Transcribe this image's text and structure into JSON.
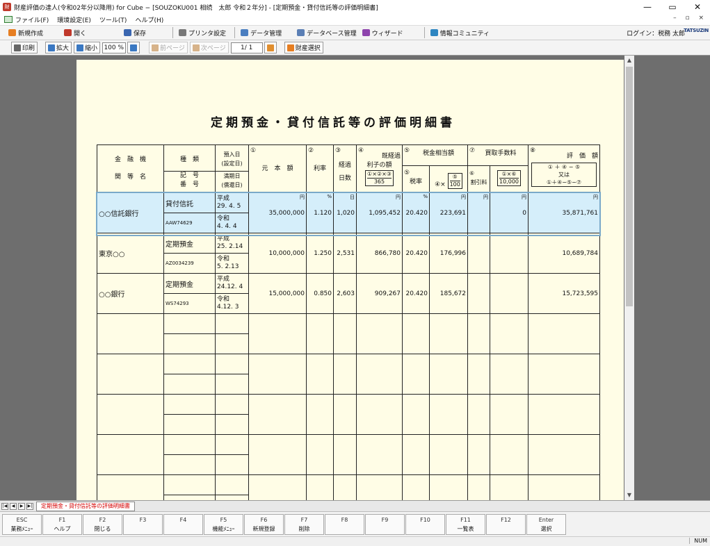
{
  "window": {
    "title": "財産評価の達人(令和02年分以降用) for Cube − [SOUZOKU001 相続　太郎 令和２年分] - [定期預金・貸付信託等の評価明細書]",
    "controls": [
      "—",
      "▭",
      "✕"
    ]
  },
  "menu": {
    "items": [
      "ファイル(F)",
      "環境設定(E)",
      "ツール(T)",
      "ヘルプ(H)"
    ],
    "mdi_controls": "– ▫ ×"
  },
  "toolbar1": {
    "new_label": "新規作成",
    "open_label": "開く",
    "save_label": "保存",
    "printer_label": "プリンタ設定",
    "data_mgmt_label": "データ管理",
    "db_mgmt_label": "データベース管理",
    "wizard_label": "ウィザード",
    "community_label": "情報コミュニティ",
    "login_text": "ログイン：税務 太郎",
    "brand": "TATSUZIN"
  },
  "toolbar2": {
    "print_label": "印刷",
    "zoom_in_label": "拡大",
    "zoom_out_label": "縮小",
    "zoom_value": "100 %",
    "prev_page_label": "前ページ",
    "next_page_label": "次ページ",
    "page_value": "1/ 1",
    "asset_select_label": "財産選択"
  },
  "document": {
    "title": "定期預金・貸付信託等の評価明細書",
    "headers": {
      "bank_top": "金　融　機",
      "bank_bottom": "関　等　名",
      "kind_top": "種　類",
      "kind_bottom1": "記　号",
      "kind_bottom2": "番　号",
      "deposit_date_top1": "預入日",
      "deposit_date_top2": "(設定日)",
      "deposit_date_bottom1": "満期日",
      "deposit_date_bottom2": "(償還日)",
      "principal_no": "①",
      "principal": "元　本　額",
      "rate_no": "②",
      "rate": "利率",
      "days_no": "③",
      "days1": "経過",
      "days2": "日数",
      "interest_no": "④",
      "interest1": "既経過",
      "interest2": "利子の額",
      "interest_formula_top": "①×②×③",
      "interest_formula_bottom": "365",
      "tax_no": "⑤",
      "tax": "税金相当額",
      "tax_rate_no": "⑤",
      "tax_rate": "税率",
      "tax_formula_top": "④×",
      "tax_formula_mid": "⑤",
      "tax_formula_bottom": "100",
      "fee_no": "⑦",
      "fee": "買取手数料",
      "fee_rate_no": "⑥",
      "fee_rate": "割引料",
      "fee_formula_top": "①×⑥",
      "fee_formula_bottom": "10,000",
      "value_no": "⑧",
      "value": "評　価　額",
      "value_formula1": "① ＋ ④ − ⑤",
      "value_formula2": "又は",
      "value_formula3": "①＋④−⑤−⑦"
    },
    "units": {
      "yen": "円",
      "percent": "%",
      "day": "日"
    },
    "rows": [
      {
        "bank": "○○信託銀行",
        "kind": "貸付信託",
        "code": "AAW74629",
        "deposit_era": "平成",
        "deposit_date": "29. 4. 5",
        "maturity_era": "令和",
        "maturity_date": "4. 4. 4",
        "principal": "35,000,000",
        "rate": "1.120",
        "days": "1,020",
        "interest": "1,095,452",
        "tax_rate": "20.420",
        "tax": "223,691",
        "fee_rate": "",
        "fee": "0",
        "value": "35,871,761"
      },
      {
        "bank": "東京○○",
        "kind": "定期預金",
        "code": "AZ0034239",
        "deposit_era": "平成",
        "deposit_date": "25. 2.14",
        "maturity_era": "令和",
        "maturity_date": "5. 2.13",
        "principal": "10,000,000",
        "rate": "1.250",
        "days": "2,531",
        "interest": "866,780",
        "tax_rate": "20.420",
        "tax": "176,996",
        "fee_rate": "",
        "fee": "",
        "value": "10,689,784"
      },
      {
        "bank": "○○銀行",
        "kind": "定期預金",
        "code": "WS74293",
        "deposit_era": "平成",
        "deposit_date": "24.12. 4",
        "maturity_era": "令和",
        "maturity_date": "4.12. 3",
        "principal": "15,000,000",
        "rate": "0.850",
        "days": "2,603",
        "interest": "909,267",
        "tax_rate": "20.420",
        "tax": "185,672",
        "fee_rate": "",
        "fee": "",
        "value": "15,723,595"
      }
    ]
  },
  "sheet_tab": "定期預金・貸付信託等の評価明細書",
  "fkeys": [
    {
      "key": "ESC",
      "label": "業務ﾒﾆｭｰ"
    },
    {
      "key": "F1",
      "label": "ヘルプ"
    },
    {
      "key": "F2",
      "label": "閉じる"
    },
    {
      "key": "F3",
      "label": ""
    },
    {
      "key": "F4",
      "label": ""
    },
    {
      "key": "F5",
      "label": "機能ﾒﾆｭｰ"
    },
    {
      "key": "F6",
      "label": "新規登録"
    },
    {
      "key": "F7",
      "label": "削除"
    },
    {
      "key": "F8",
      "label": ""
    },
    {
      "key": "F9",
      "label": ""
    },
    {
      "key": "F10",
      "label": ""
    },
    {
      "key": "F11",
      "label": "一覧表"
    },
    {
      "key": "F12",
      "label": ""
    },
    {
      "key": "Enter",
      "label": "選択"
    }
  ],
  "status": {
    "num": "NUM"
  },
  "colors": {
    "paper": "#fffde6",
    "viewer_bg": "#6e6e6e",
    "selected_row": "#d5eefa",
    "tab_text": "#d40000"
  }
}
